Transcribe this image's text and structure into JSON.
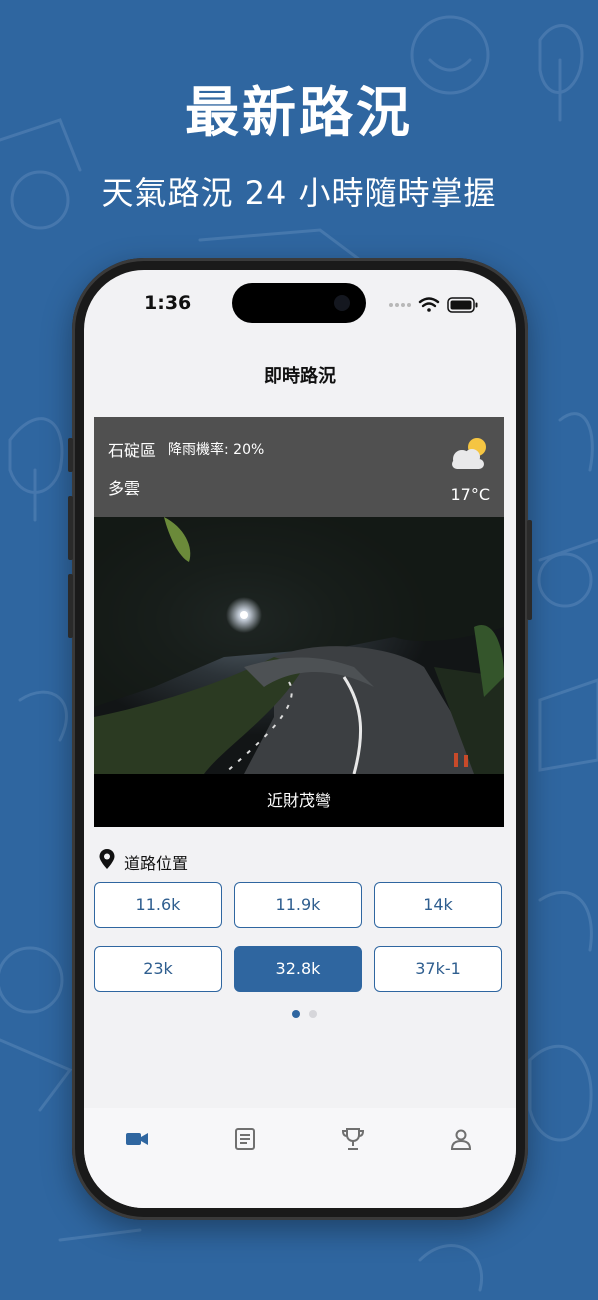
{
  "headline": {
    "title": "最新路況",
    "subtitle": "天氣路況 24 小時隨時掌握"
  },
  "status_bar": {
    "time": "1:36"
  },
  "screen": {
    "nav_title": "即時路況"
  },
  "weather": {
    "district": "石碇區",
    "rain_label": "降雨機率:",
    "rain_value": "20%",
    "condition": "多雲",
    "temperature": "17°C",
    "icon": "partly-cloudy-icon"
  },
  "camera": {
    "name": "近財茂彎",
    "image": "night-road-camera-view"
  },
  "road_location": {
    "label": "道路位置",
    "buttons": [
      {
        "label": "11.6k",
        "active": false
      },
      {
        "label": "11.9k",
        "active": false
      },
      {
        "label": "14k",
        "active": false
      },
      {
        "label": "23k",
        "active": false
      },
      {
        "label": "32.8k",
        "active": true
      },
      {
        "label": "37k-1",
        "active": false
      }
    ]
  },
  "pagination": {
    "pages": 2,
    "current": 1
  },
  "tabs": [
    {
      "icon": "video-camera-icon",
      "active": true
    },
    {
      "icon": "document-icon",
      "active": false
    },
    {
      "icon": "trophy-icon",
      "active": false
    },
    {
      "icon": "user-icon",
      "active": false
    }
  ],
  "colors": {
    "brand_blue": "#2f66a0",
    "background": "#2f66a0",
    "weather_bar": "#505050",
    "accent_sun": "#f5c542"
  }
}
